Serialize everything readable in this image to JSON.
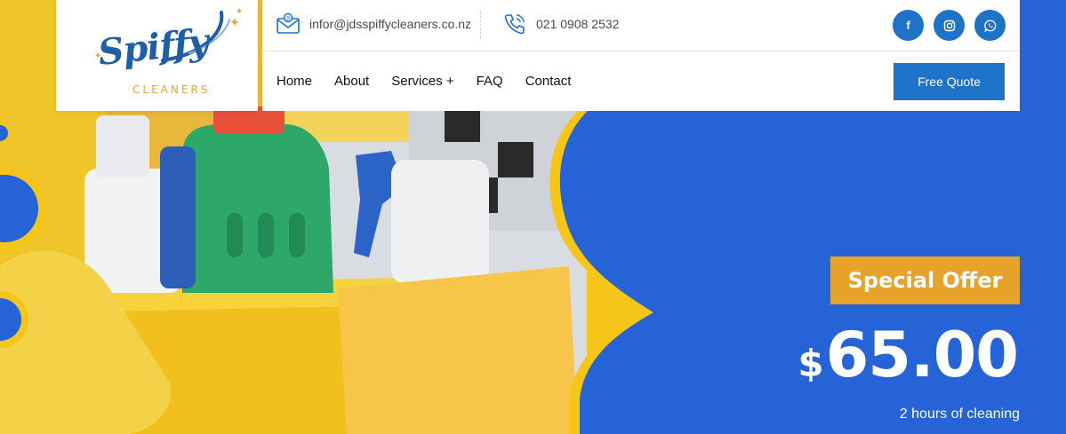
{
  "logo": {
    "wordmark": "Spiffy",
    "subtitle": "CLEANERS"
  },
  "contact": {
    "email": "infor@jdsspiffycleaners.co.nz",
    "phone": "021 0908 2532",
    "email_icon": "envelope-icon",
    "phone_icon": "phone-call-icon"
  },
  "social": [
    {
      "name": "facebook",
      "icon": "facebook-icon",
      "glyph": "f"
    },
    {
      "name": "instagram",
      "icon": "instagram-icon",
      "glyph": ""
    },
    {
      "name": "whatsapp",
      "icon": "whatsapp-icon",
      "glyph": ""
    }
  ],
  "nav": {
    "items": [
      {
        "label": "Home"
      },
      {
        "label": "About"
      },
      {
        "label": "Services +"
      },
      {
        "label": "FAQ"
      },
      {
        "label": "Contact"
      }
    ],
    "cta_label": "Free Quote"
  },
  "offer": {
    "badge": "Special Offer",
    "currency": "$",
    "amount": "65.00",
    "note": "2 hours of cleaning"
  },
  "colors": {
    "hero_blue": "#2563d6",
    "brand_blue": "#1e73c8",
    "accent_yellow": "#e6a229",
    "wave_yellow": "#f5c518"
  }
}
